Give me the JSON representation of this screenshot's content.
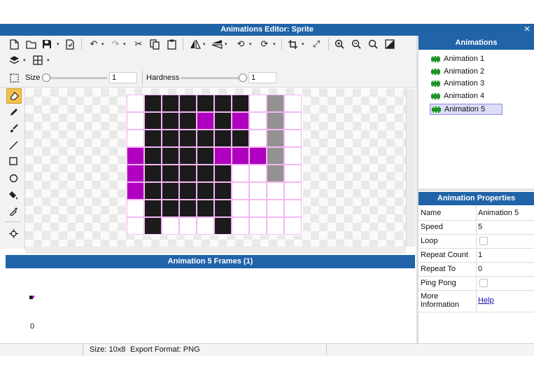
{
  "window": {
    "title": "Animations Editor: Sprite",
    "close_glyph": "×"
  },
  "toolbar": {
    "size_label": "Size",
    "size_value": "1",
    "hardness_label": "Hardness",
    "hardness_value": "1"
  },
  "sprite": {
    "rows": [
      "_KKKKKK_G_",
      "_KKKPKP_G_",
      "_KKKKKK_G_",
      "PKKKKPPPG_",
      "PKKKKK__G_",
      "PKKKKK____",
      "_KKKKK____",
      "_K___K____"
    ],
    "colors": {
      "K": "#1b1b1b",
      "P": "#b000bf",
      "G": "#929292"
    }
  },
  "frames": {
    "title": "Animation 5 Frames (1)",
    "items": [
      {
        "index": "0"
      }
    ]
  },
  "status": {
    "size": "Size: 10x8",
    "export": "Export Format: PNG"
  },
  "animations": {
    "title": "Animations",
    "items": [
      "Animation 1",
      "Animation 2",
      "Animation 3",
      "Animation 4",
      "Animation 5"
    ],
    "selected": 4
  },
  "properties": {
    "title": "Animation Properties",
    "name_label": "Name",
    "name_value": "Animation 5",
    "speed_label": "Speed",
    "speed_value": "5",
    "loop_label": "Loop",
    "repeat_count_label": "Repeat Count",
    "repeat_count_value": "1",
    "repeat_to_label": "Repeat To",
    "repeat_to_value": "0",
    "ping_pong_label": "Ping Pong",
    "more_info_label_1": "More",
    "more_info_label_2": "Information",
    "help_label": "Help"
  },
  "colors": {
    "accent": "#2063a8",
    "selection": "#dcdcf8",
    "link": "#1a0dab"
  }
}
